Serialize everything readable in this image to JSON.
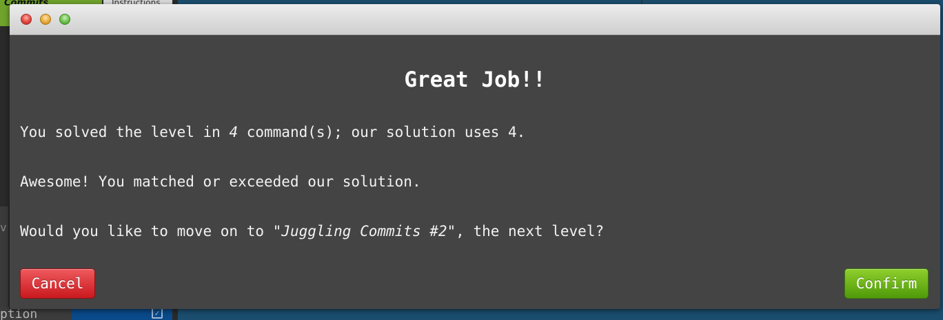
{
  "background_app": {
    "tab_commits": "Commits",
    "tab_instructions": "Instructions",
    "stray_char": "v",
    "option_label": "ption"
  },
  "modal": {
    "title": "Great Job!!",
    "line1": {
      "prefix": "You solved the level in ",
      "user_count": "4",
      "suffix": " command(s); our solution uses 4."
    },
    "line2": "Awesome! You matched or exceeded our solution.",
    "line3": {
      "prefix": "Would you like to move on to ",
      "level_name": "\"Juggling Commits #2\"",
      "suffix": ", the next level?"
    },
    "cancel_label": "Cancel",
    "confirm_label": "Confirm"
  },
  "colors": {
    "modal_bg": "#444444",
    "cancel": "#d8262b",
    "confirm": "#6cb619"
  }
}
